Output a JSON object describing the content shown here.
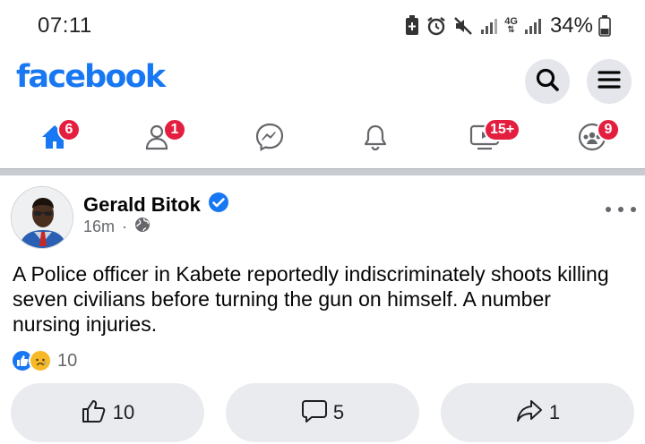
{
  "status_bar": {
    "time": "07:11",
    "network": "4G",
    "battery": "34%",
    "icons": [
      "battery-saver-icon",
      "alarm-icon",
      "mute-icon",
      "signal-icon",
      "network-4g-icon",
      "signal-icon",
      "battery-icon"
    ]
  },
  "header": {
    "logo": "facebook",
    "brand_color": "#1877f2",
    "buttons": [
      "search-icon",
      "menu-icon"
    ]
  },
  "tabs": [
    {
      "name": "home",
      "icon": "home-icon",
      "badge": "6",
      "active": true
    },
    {
      "name": "friends",
      "icon": "friends-icon",
      "badge": "1"
    },
    {
      "name": "messenger",
      "icon": "messenger-icon",
      "badge": ""
    },
    {
      "name": "notifications",
      "icon": "bell-icon",
      "badge": ""
    },
    {
      "name": "watch",
      "icon": "video-icon",
      "badge": "15+"
    },
    {
      "name": "groups",
      "icon": "groups-icon",
      "badge": "9"
    }
  ],
  "badge_color": "#e41e3f",
  "post": {
    "author": "Gerald Bitok",
    "verified": true,
    "time": "16m",
    "separator": "·",
    "audience_icon": "globe-icon",
    "text": "A Police officer in Kabete reportedly indiscriminately shoots killing seven civilians before turning the gun on himself. A number nursing  injuries.",
    "reactions": {
      "types": [
        "like-icon",
        "sad-icon"
      ],
      "count": "10"
    },
    "actions": {
      "like_count": "10",
      "comment_count": "5",
      "share_count": "1"
    }
  }
}
